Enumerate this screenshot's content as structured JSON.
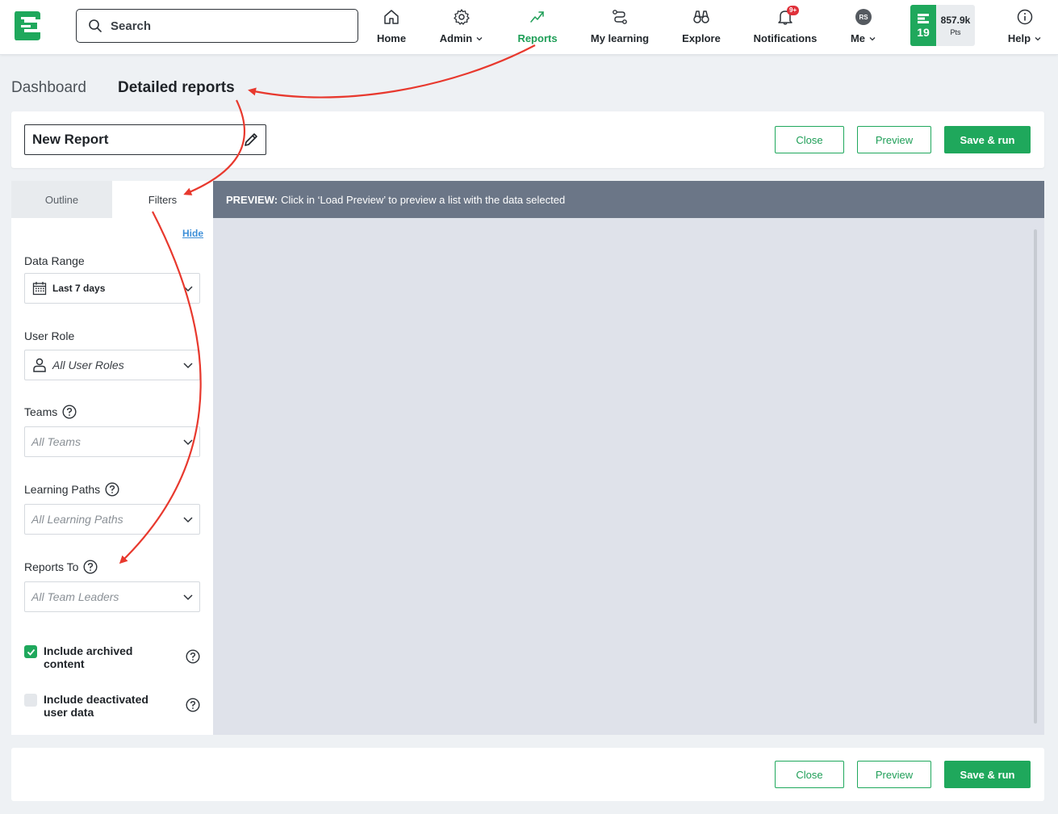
{
  "topbar": {
    "search_placeholder": "Search",
    "nav": {
      "home": "Home",
      "admin": "Admin",
      "reports": "Reports",
      "my_learning": "My learning",
      "explore": "Explore",
      "notifications": "Notifications",
      "notifications_badge": "9+",
      "me": "Me",
      "avatar_initials": "RS",
      "help": "Help"
    },
    "points": {
      "level": "19",
      "value": "857.9k",
      "unit": "Pts"
    }
  },
  "page_tabs": {
    "dashboard": "Dashboard",
    "detailed_reports": "Detailed reports"
  },
  "header": {
    "report_name": "New Report",
    "close": "Close",
    "preview": "Preview",
    "save_run": "Save & run"
  },
  "left_panel": {
    "tabs": {
      "outline": "Outline",
      "filters": "Filters"
    },
    "hide": "Hide",
    "filters": {
      "data_range": {
        "label": "Data Range",
        "value": "Last 7 days"
      },
      "user_role": {
        "label": "User Role",
        "value": "All User Roles"
      },
      "teams": {
        "label": "Teams",
        "value": "All Teams"
      },
      "learning_paths": {
        "label": "Learning Paths",
        "value": "All Learning Paths"
      },
      "reports_to": {
        "label": "Reports To",
        "value": "All Team Leaders"
      }
    },
    "checkboxes": {
      "archived": {
        "label": "Include archived content",
        "checked": true
      },
      "deactivated": {
        "label": "Include deactivated user data",
        "checked": false
      }
    }
  },
  "preview": {
    "prefix": "PREVIEW:",
    "message": "Click in ‘Load Preview’ to preview a list with the data selected"
  },
  "footer": {
    "close": "Close",
    "preview": "Preview",
    "save_run": "Save & run"
  },
  "colors": {
    "brand_green": "#1fa85c",
    "annotation_red": "#e8392e",
    "preview_bar": "#6b7687"
  }
}
